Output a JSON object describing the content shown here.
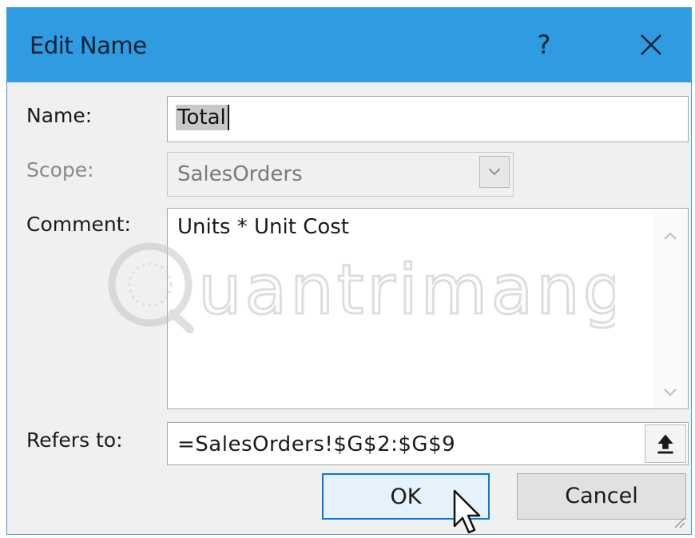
{
  "window": {
    "title": "Edit Name",
    "help_label": "?",
    "close_icon": "close-icon"
  },
  "form": {
    "name": {
      "label": "Name:",
      "value": "Total"
    },
    "scope": {
      "label": "Scope:",
      "value": "SalesOrders",
      "enabled": false
    },
    "comment": {
      "label": "Comment:",
      "value": "Units * Unit Cost"
    },
    "refers_to": {
      "label": "Refers to:",
      "value": "=SalesOrders!$G$2:$G$9"
    }
  },
  "buttons": {
    "ok": "OK",
    "cancel": "Cancel"
  },
  "watermark": {
    "text": "Quantrimang"
  },
  "colors": {
    "titlebar": "#2f9be0",
    "dialog_bg": "#f0f0f0",
    "ok_border": "#0a78d7"
  }
}
